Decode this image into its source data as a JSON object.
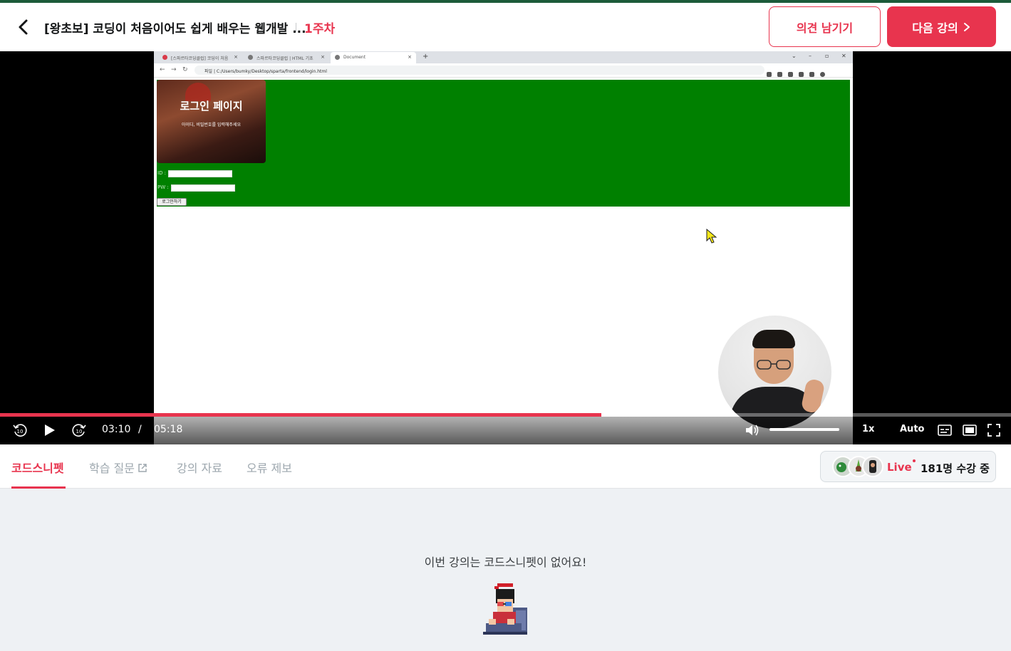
{
  "header": {
    "course_title": "[왕초보] 코딩이 처음이어도 쉽게 배우는 웹개발 ...",
    "week": "1주차",
    "feedback_button": "의견 남기기",
    "next_button": "다음 강의"
  },
  "video": {
    "browser": {
      "tabs": [
        "[스파르타코딩클럽] 코딩이 처음",
        "스파르타코딩클럽 | HTML 기초",
        "Document"
      ],
      "url_prefix": "파일",
      "url": "C:/Users/bumky/Desktop/sparta/frontend/login.html"
    },
    "page": {
      "hero_title": "로그인 페이지",
      "hero_subtitle": "아이디, 비밀번호를 입력해주세요",
      "id_label": "ID :",
      "pw_label": "PW :",
      "login_button": "로그인하기"
    },
    "player": {
      "current_time": "03:10",
      "time_separator": "/",
      "duration": "05:18",
      "progress": 0.595,
      "volume": 1.0,
      "speed": "1x",
      "quality": "Auto"
    }
  },
  "tabs": {
    "items": [
      "코드스니펫",
      "학습 질문",
      "강의 자료",
      "오류 제보"
    ],
    "active": "코드스니펫"
  },
  "live": {
    "label": "Live",
    "count": "181명 수강 중"
  },
  "content": {
    "empty_message": "이번 강의는 코드스니펫이 없어요!"
  },
  "colors": {
    "accent": "#e8344e",
    "green_page": "#008000"
  }
}
